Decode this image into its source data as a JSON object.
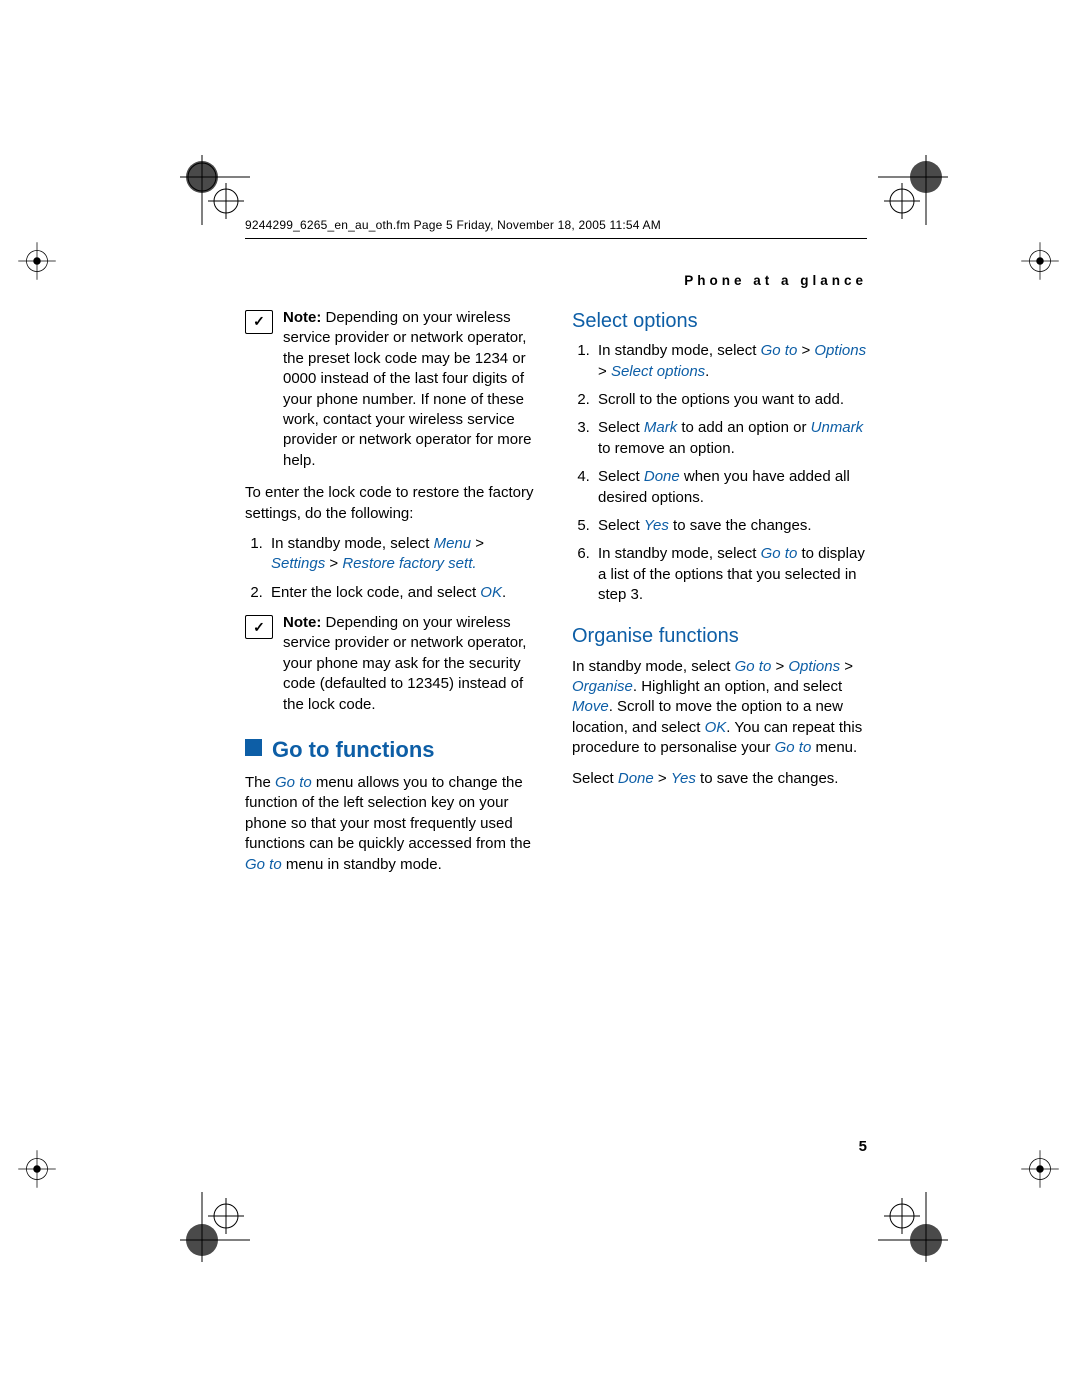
{
  "runhead": "9244299_6265_en_au_oth.fm  Page 5  Friday, November 18, 2005  11:54 AM",
  "section_label": "Phone at a glance",
  "page_number": "5",
  "left": {
    "note1_prefix": "Note:",
    "note1_body": " Depending on your wireless service provider or network operator, the preset lock code may be 1234 or 0000 instead of the last four digits of your phone number. If none of these work, contact your wireless service provider or network operator for more help.",
    "intro": "To enter the lock code to restore the factory settings, do the following:",
    "step1_a": "In standby mode, select ",
    "step1_b": "Menu",
    "step1_c": " > ",
    "step1_d": "Settings",
    "step1_e": " > ",
    "step1_f": "Restore factory sett.",
    "step2_a": "Enter the lock code, and select ",
    "step2_b": "OK",
    "step2_c": ".",
    "note2_prefix": "Note:",
    "note2_body": " Depending on your wireless service provider or network operator, your phone may ask for the security code (defaulted to 12345) instead of the lock code.",
    "h_goto": "Go to functions",
    "goto_p_a": "The ",
    "goto_p_b": "Go to",
    "goto_p_c": " menu allows you to change the function of the left selection key on your phone so that your most frequently used functions can be quickly accessed from the ",
    "goto_p_d": "Go to",
    "goto_p_e": " menu in standby mode."
  },
  "right": {
    "h_select": "Select options",
    "s1_a": "In standby mode, select ",
    "s1_b": "Go to",
    "s1_c": " > ",
    "s1_d": "Options",
    "s1_e": " > ",
    "s1_f": "Select options",
    "s1_g": ".",
    "s2": "Scroll to the options you want to add.",
    "s3_a": "Select ",
    "s3_b": "Mark",
    "s3_c": " to add an option or ",
    "s3_d": "Unmark",
    "s3_e": " to remove an option.",
    "s4_a": "Select ",
    "s4_b": "Done",
    "s4_c": " when you have added all desired options.",
    "s5_a": "Select ",
    "s5_b": "Yes",
    "s5_c": " to save the changes.",
    "s6_a": "In standby mode, select ",
    "s6_b": "Go to",
    "s6_c": " to display a list of the options that you selected in step 3.",
    "h_org": "Organise functions",
    "org_p1_a": "In standby mode, select ",
    "org_p1_b": "Go to",
    "org_p1_c": " > ",
    "org_p1_d": "Options",
    "org_p1_e": " > ",
    "org_p1_f": "Organise",
    "org_p1_g": ". Highlight an option, and select ",
    "org_p1_h": "Move",
    "org_p1_i": ". Scroll to move the option to a new location, and select ",
    "org_p1_j": "OK",
    "org_p1_k": ". You can repeat this procedure to personalise your ",
    "org_p1_l": "Go to",
    "org_p1_m": " menu.",
    "org_p2_a": "Select ",
    "org_p2_b": "Done",
    "org_p2_c": " > ",
    "org_p2_d": "Yes",
    "org_p2_e": " to save the changes."
  }
}
